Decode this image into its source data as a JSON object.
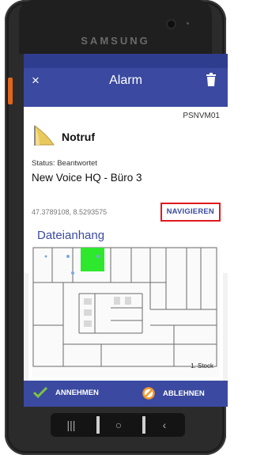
{
  "device": {
    "brand": "SAMSUNG"
  },
  "appbar": {
    "title": "Alarm",
    "close_symbol": "×",
    "close_icon": "close-icon",
    "delete_icon": "trash-icon"
  },
  "alarm": {
    "device_id": "PSNVM01",
    "type": "Notruf",
    "status": "Status: Beantwortet",
    "location": "New Voice HQ - Büro 3",
    "coordinates": "47.3789108, 8.5293575",
    "navigate_label": "NAVIGIEREN"
  },
  "attachment": {
    "title": "Dateianhang",
    "floor_label": "1. Stock"
  },
  "actions": {
    "accept_label": "ANNEHMEN",
    "reject_label": "ABLEHNEN"
  },
  "navkeys": {
    "recent": "|||",
    "home": "○",
    "back": "‹"
  },
  "colors": {
    "primary": "#3b4aa0",
    "highlight_border": "#e0191e",
    "accept_icon": "#7cc243",
    "reject_icon": "#f39a2a",
    "room_highlight": "#2ee82e"
  }
}
